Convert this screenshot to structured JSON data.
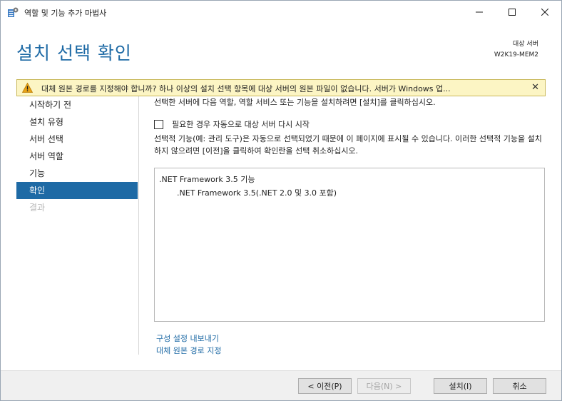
{
  "window": {
    "title": "역할 및 기능 추가 마법사",
    "icon": "server-manager-icon",
    "controls": {
      "minimize_glyph": "—",
      "maximize_glyph": "☐",
      "close_glyph": "✕"
    }
  },
  "header": {
    "title": "설치 선택 확인",
    "target_server_label": "대상 서버",
    "target_server_name": "W2K19-MEM2"
  },
  "warning": {
    "message": "대체 원본 경로를 지정해야 합니까? 하나 이상의 설치 선택 항목에 대상 서버의 원본 파일이 없습니다. 서버가 Windows 업...",
    "close_glyph": "✕",
    "icon": "warning-icon",
    "background": "#fcf5c4"
  },
  "nav": {
    "items": [
      {
        "label": "시작하기 전",
        "state": "normal"
      },
      {
        "label": "설치 유형",
        "state": "normal"
      },
      {
        "label": "서버 선택",
        "state": "normal"
      },
      {
        "label": "서버 역할",
        "state": "normal"
      },
      {
        "label": "기능",
        "state": "normal"
      },
      {
        "label": "확인",
        "state": "active"
      },
      {
        "label": "결과",
        "state": "disabled"
      }
    ],
    "active_color": "#1e6aa5"
  },
  "main": {
    "intro": "선택한 서버에 다음 역할, 역할 서비스 또는 기능을 설치하려면 [설치]를 클릭하십시오.",
    "restart_checkbox": {
      "label": "필요한 경우 자동으로 대상 서버 다시 시작",
      "checked": false
    },
    "description": "선택적 기능(예: 관리 도구)은 자동으로 선택되었기 때문에 이 페이지에 표시될 수 있습니다. 이러한 선택적 기능을 설치하지 않으려면 [이전]을 클릭하여 확인란을 선택 취소하십시오.",
    "features": [
      ".NET Framework 3.5 기능",
      ".NET Framework 3.5(.NET 2.0 및 3.0 포함)"
    ],
    "links": {
      "export": "구성 설정 내보내기",
      "alternate_source": "대체 원본 경로 지정"
    }
  },
  "footer": {
    "prev": "< 이전(P)",
    "next": "다음(N) >",
    "install": "설치(I)",
    "cancel": "취소"
  }
}
